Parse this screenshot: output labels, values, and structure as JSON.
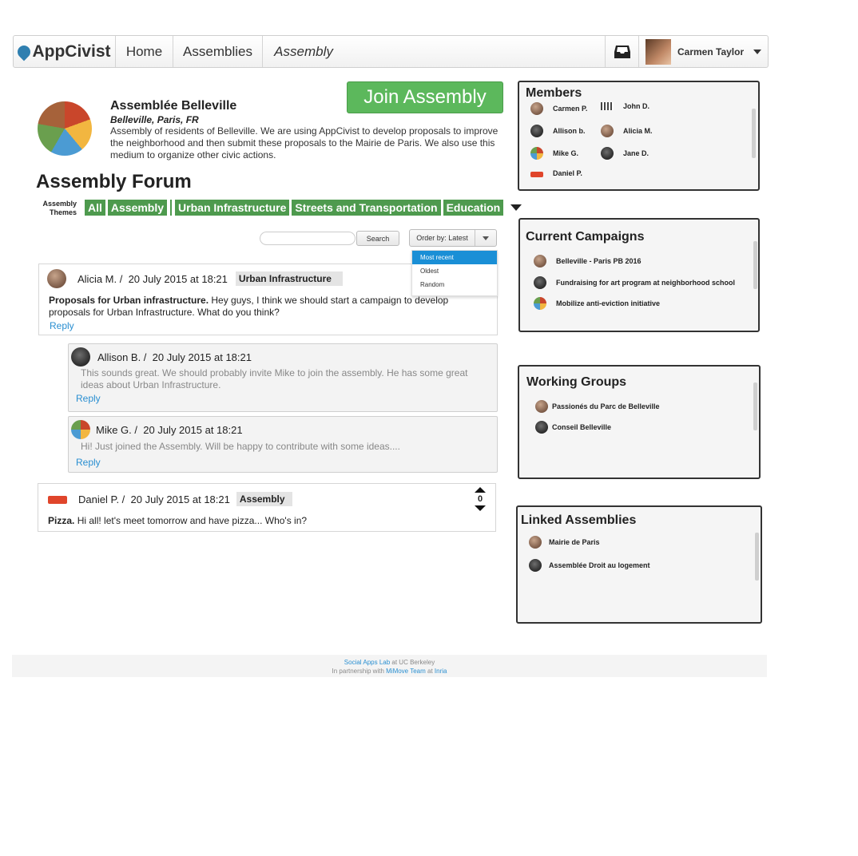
{
  "nav": {
    "logo": "AppCivist",
    "home": "Home",
    "assemblies": "Assemblies",
    "assembly": "Assembly",
    "user_name": "Carmen Taylor"
  },
  "assembly": {
    "name": "Assemblée Belleville",
    "location": "Belleville, Paris, FR",
    "description": "Assembly of residents of Belleville. We are using AppCivist to develop proposals to improve the neighborhood and then submit these proposals to the Mairie de Paris. We also use this medium to organize other civic actions.",
    "join_label": "Join Assembly"
  },
  "forum": {
    "title": "Assembly Forum",
    "themes_label": "Assembly Themes",
    "themes": [
      "All",
      "Assembly",
      "Urban Infrastructure",
      "Streets and Transportation",
      "Education"
    ],
    "search_label": "Search",
    "order_label": "Order by: Latest",
    "order_options": [
      "Most recent",
      "Oldest",
      "Random"
    ]
  },
  "posts": [
    {
      "author": "Alicia M. /",
      "date": "20 July 2015 at 18:21",
      "tag": "Urban Infrastructure",
      "title": "Proposals for Urban infrastructure.",
      "body": " Hey guys, I think we should start a campaign to develop proposals for Urban Infrastructure. What do you think?",
      "reply": "Reply"
    },
    {
      "author": "Allison B. /",
      "date": "20 July 2015 at 18:21",
      "body": "This sounds great. We should probably invite Mike to join the assembly. He has some great ideas about Urban Infrastructure.",
      "reply": "Reply"
    },
    {
      "author": "Mike G. /",
      "date": "20 July 2015 at 18:21",
      "body": "Hi! Just joined the Assembly. Will be happy to contribute with some ideas....",
      "reply": "Reply"
    },
    {
      "author": "Daniel P. /",
      "date": "20 July 2015 at 18:21",
      "tag": "Assembly",
      "title": "Pizza.",
      "body": " Hi all! let's meet tomorrow and have pizza... Who's in?",
      "votes": "0"
    }
  ],
  "members": {
    "title": "Members",
    "items": [
      "Carmen P.",
      "John D.",
      "Allison b.",
      "Alicia M.",
      "Mike G.",
      "Jane D.",
      "Daniel P."
    ]
  },
  "campaigns": {
    "title": "Current Campaigns",
    "items": [
      "Belleville - Paris PB 2016",
      "Fundraising for art program at neighborhood school",
      "Mobilize anti-eviction initiative"
    ]
  },
  "working_groups": {
    "title": "Working Groups",
    "items": [
      "Passionés du Parc de Belleville",
      "Conseil Belleville"
    ]
  },
  "linked": {
    "title": "Linked Assemblies",
    "items": [
      "Mairie de Paris",
      "Assemblée Droit au logement"
    ]
  },
  "footer": {
    "lab": "Social Apps Lab",
    "at1": " at UC Berkeley",
    "partner": "In partnership with ",
    "team": "MiMove Team",
    "at2": " at ",
    "inria": "Inria"
  }
}
